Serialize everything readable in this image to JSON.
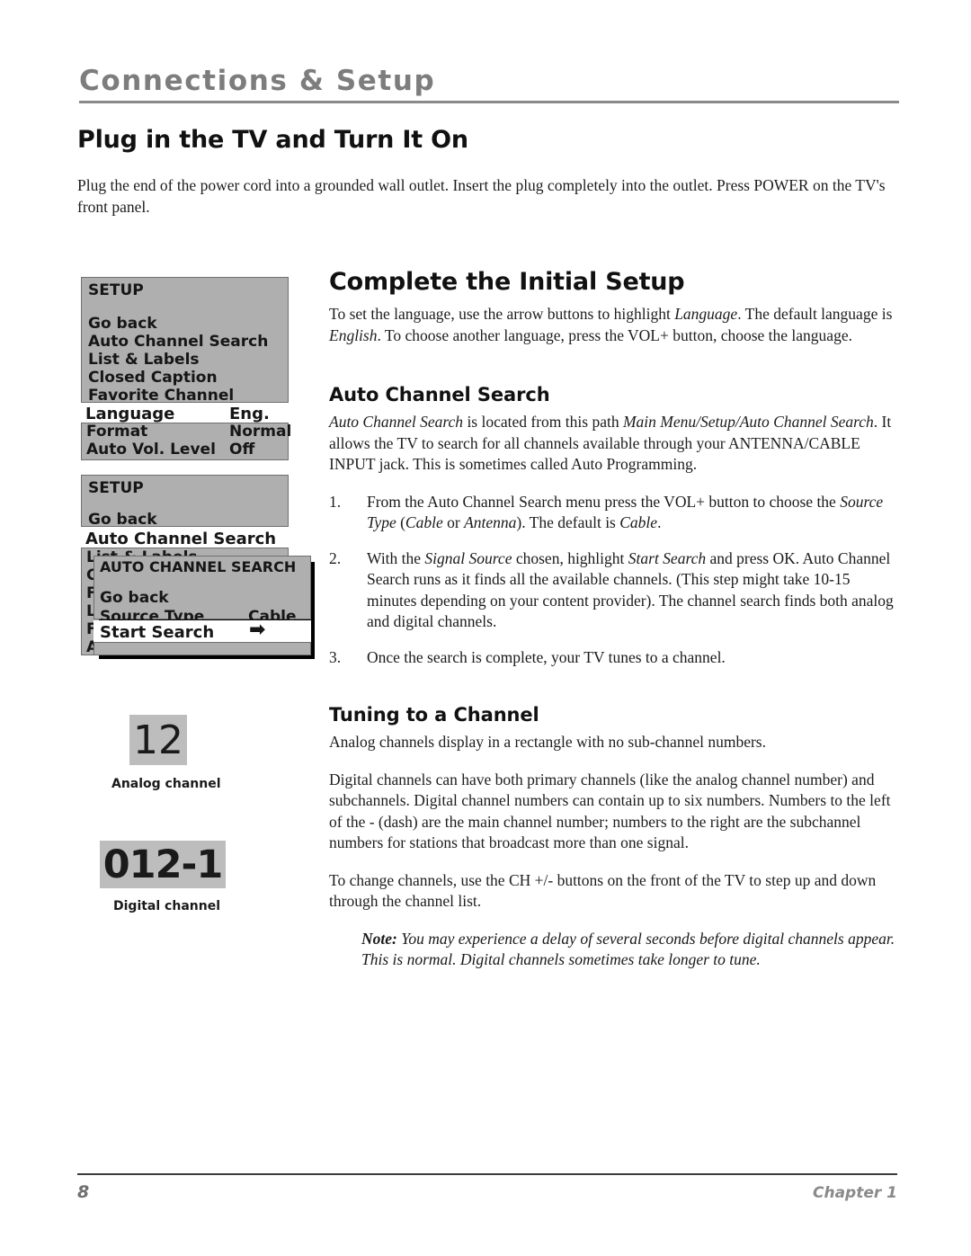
{
  "running_head": {
    "title": "Connections & Setup"
  },
  "intro": {
    "heading": "Plug in the TV and Turn It On",
    "paragraph": "Plug the end of the power cord into a grounded wall outlet. Insert the plug completely into the outlet. Press POWER on the TV's front panel."
  },
  "main": {
    "initial_setup": {
      "heading": "Complete the Initial Setup",
      "paragraph_parts": {
        "p1": "To set the language, use the arrow buttons to highlight ",
        "i1": "Language",
        "p2": ". The default language is ",
        "i2": "English",
        "p3": ". To choose another language, press the VOL+ button, choose the language."
      }
    },
    "auto_channel_search": {
      "heading": "Auto Channel Search",
      "paragraph_parts": {
        "i1": "Auto Channel Search",
        "p1": " is located from this path ",
        "i2": "Main Menu/Setup/Auto Channel Search",
        "p2": ". It allows the TV to search for all channels available through your ANTENNA/CABLE INPUT jack. This is sometimes called Auto Programming."
      },
      "steps": [
        {
          "num": "1.",
          "parts": {
            "p1": "From the Auto Channel Search menu press the VOL+ button to choose the ",
            "i1": "Source Type",
            "p2": " (",
            "i2": "Cable",
            "p3": " or ",
            "i3": "Antenna",
            "p4": "). The default is ",
            "i4": "Cable",
            "p5": "."
          }
        },
        {
          "num": "2.",
          "parts": {
            "p1": "With the ",
            "i1": "Signal Source",
            "p2": " chosen, highlight ",
            "i2": "Start Search",
            "p3": " and press OK. Auto Channel Search runs as it finds all the available channels. (This step might take 10-15 minutes depending on your content provider). The channel search finds both analog and digital channels."
          }
        },
        {
          "num": "3.",
          "parts": {
            "p1": "Once the search is complete, your TV tunes to a channel."
          }
        }
      ]
    },
    "tuning": {
      "heading": "Tuning to a Channel",
      "para1": "Analog channels display in a rectangle with no sub-channel numbers.",
      "para2": "Digital channels can have both primary channels (like the analog channel number) and subchannels. Digital channel numbers can contain up to six numbers. Numbers to the left of the - (dash) are the main channel number; numbers to the right are the subchannel numbers for stations that broadcast more than one signal.",
      "para3": "To change channels, use the CH +/- buttons on the front of the TV to step up and down through the channel list.",
      "note": {
        "label": "Note:",
        "text": " You may experience a delay of several seconds before digital channels appear. This is normal. Digital channels sometimes take longer to tune."
      }
    }
  },
  "osd_menu_1": {
    "title": "SETUP",
    "items": [
      {
        "label": "Go back",
        "value": ""
      },
      {
        "label": "Auto Channel Search",
        "value": ""
      },
      {
        "label": "List & Labels",
        "value": ""
      },
      {
        "label": "Closed Caption",
        "value": ""
      },
      {
        "label": "Favorite Channel",
        "value": ""
      },
      {
        "label": "Language",
        "value": "Eng."
      },
      {
        "label": "Format",
        "value": "Normal"
      },
      {
        "label": "Auto Vol. Level",
        "value": "Off"
      }
    ],
    "highlighted_index": 5
  },
  "osd_menu_2": {
    "title": "SETUP",
    "items": [
      {
        "label": "Go back"
      },
      {
        "label": "Auto Channel Search"
      },
      {
        "label": "List & Labels"
      },
      {
        "label": "Closed Caption"
      },
      {
        "label": "Favorite Channel"
      },
      {
        "label": "Language"
      },
      {
        "label": "Format"
      },
      {
        "label": "Auto Vol. Level"
      }
    ],
    "highlighted_index": 1,
    "obscured_initials": [
      "C",
      "F",
      "L",
      "F",
      "A"
    ]
  },
  "osd_submenu": {
    "title": "AUTO CHANNEL SEARCH",
    "items": [
      {
        "label": "Go back",
        "value": ""
      },
      {
        "label": "Source Type",
        "value": "Cable"
      },
      {
        "label": "Start Search",
        "value": "arrow-right-icon"
      }
    ],
    "highlighted_index": 2,
    "arrow_glyph": "➡"
  },
  "channel_graphics": {
    "analog": {
      "number": "12",
      "caption": "Analog channel"
    },
    "digital": {
      "number": "012-1",
      "caption": "Digital channel"
    }
  },
  "footer": {
    "page_number": "8",
    "chapter": "Chapter 1"
  },
  "colors": {
    "running_head": "#7d7d7d",
    "osd_gray": "#afafaf",
    "osd_highlight": "#ffffff",
    "channel_gray": "#bdbdbd",
    "footer_gray": "#8a8a8a"
  }
}
